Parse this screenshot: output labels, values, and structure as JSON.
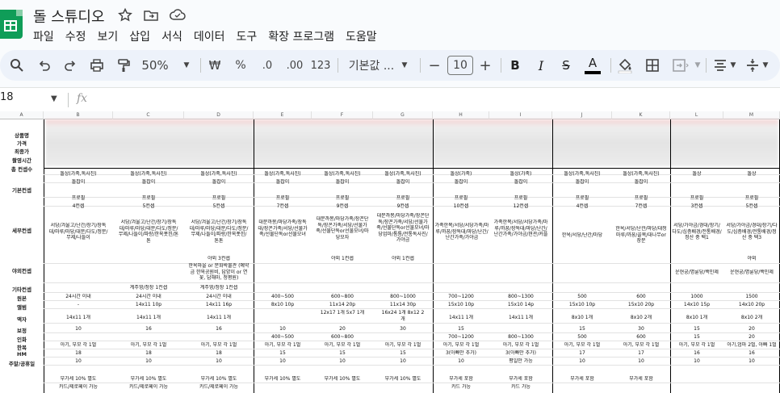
{
  "app": {
    "doc_title": "돌 스튜디오",
    "menu": [
      "파일",
      "수정",
      "보기",
      "삽입",
      "서식",
      "데이터",
      "도구",
      "확장 프로그램",
      "도움말"
    ]
  },
  "toolbar": {
    "zoom": "50%",
    "currency": "₩",
    "percent": "%",
    "dec_decrease": ".0",
    "dec_increase": ".00",
    "number_format": "123",
    "font_name": "기본값 ...",
    "font_size": "10",
    "minus": "−",
    "plus": "+",
    "bold": "B",
    "italic": "I",
    "strike": "S",
    "text_color": "A"
  },
  "formula_bar": {
    "cell_ref": "18",
    "fx": "fx"
  },
  "columns": [
    "A",
    "B",
    "C",
    "D",
    "E",
    "F",
    "G",
    "H",
    "I",
    "J",
    "K",
    "L",
    "M"
  ],
  "row_labels": {
    "r1": "상품명",
    "r2": "가격",
    "r3": "최종가",
    "r4": "촬영시간",
    "r5": "총 컨셉수",
    "r6": "기본컨셉",
    "r7": "세부컨셉",
    "r8": "야외컨셉",
    "r9": "기타컨셉",
    "r10": "원본",
    "r11": "앨범",
    "r12": "액자",
    "r13": "보정",
    "r14": "인화",
    "r15": "한복",
    "r16": "HM",
    "r17": "주말/공휴일"
  },
  "cells": {
    "B": {
      "row18": "돌상(가족,독사진)",
      "row19": "돌잡이",
      "row20": "프로필",
      "row21": "4컨셉",
      "detail": "서당/겨울고/난간/장기/장독대/마루/마당/대문/다도/정문/무제/나들이",
      "orig": "24시간 이내",
      "album": "-",
      "frame": "14x11 1개",
      "retouch": "10",
      "hanbok": "아기, 부모 각 1벌",
      "hm": "18",
      "weekend": "10",
      "extra": "부가세 10% 별도",
      "card": "카드/제로페이 가능"
    },
    "C": {
      "row18": "돌상(가족,독사진)",
      "row19": "돌잡이",
      "row20": "프로필",
      "row21": "5컨셉",
      "detail": "서당/겨울고/난간/장기/장독대/마루/마당/대문/다도/정문/무제/나들이/파랑/한옥폿힌/톤톤",
      "etc": "계주영/정장 1컨셉",
      "orig": "24시간 이내",
      "album": "14x11 10p",
      "frame": "14x11 1개",
      "retouch": "16",
      "hanbok": "아기, 부모 각 1벌",
      "hm": "18",
      "weekend": "10",
      "extra": "부가세 10% 별도",
      "card": "카드/제로페이 가능"
    },
    "D": {
      "row18": "돌상(가족,독사진)",
      "row19": "돌잡이",
      "row20": "프로필",
      "row21": "5컨셉",
      "detail": "서당/겨울고/난간/장기/장독대/마루/마당/대문/다도/정문/무제/나들이/파랑/한옥폿힌/톤톤",
      "outdoor1": "야외 3컨셉",
      "outdoor2": "한옥마을 or 문화박물관 (예약금 한옥공원비, 답양이 or 연꽃, 답해마, 청평원)",
      "etc": "계주영/정장 1컨셉",
      "orig": "24시간 이내",
      "album": "14x11 16p",
      "frame": "14x11 1개",
      "retouch": "16",
      "hanbok": "아기, 부모 각 1벌",
      "hm": "18",
      "weekend": "10",
      "extra": "부가세 10% 별도",
      "card": "카드/제로페이 가능"
    },
    "E": {
      "row18": "돌상(가족,독사진)",
      "row19": "돌잡이",
      "row20": "프로필",
      "row21": "7컨셉",
      "detail": "대문까몽/마당가족/장독대/장꼰가족/서당/선물가족/선물단독or선물모녀",
      "orig": "400~500",
      "album": "8x10 10p",
      "frame": "",
      "retouch": "10",
      "print": "400~500",
      "hanbok": "아기, 부모 각 1벌",
      "hm": "15",
      "weekend": "10",
      "extra": "부가세 10% 별도"
    },
    "F": {
      "row18": "돌상(가족,독사진)",
      "row19": "돌잡이",
      "row20": "프로필",
      "row21": "9컨셉",
      "detail": "대문까몽/마당가족/장꼰단독/장꼰가족/서당/선물가족/선물단독or선물모녀/마당모자",
      "outdoor1": "야외 1컨셉",
      "orig": "600~800",
      "album": "11x14 20p",
      "frame": "12x17 1개 5x7 1개",
      "retouch": "20",
      "print": "600~800",
      "hanbok": "아기, 부모 각 1벌",
      "hm": "15",
      "weekend": "10",
      "extra": "부가세 10% 별도"
    },
    "G": {
      "row18": "돌상(가족,독사진)",
      "row19": "돌잡이",
      "row20": "프로필",
      "row21": "9컨셉",
      "detail": "대문까몽/마당가족/장꼰단독/장꼰가족/서당/선물가족/선물단독or선물모녀/마당업마/톰톰/전통독사진/가야금",
      "outdoor1": "야외 1컨셉",
      "orig": "800~1000",
      "album": "11x14 30p",
      "frame": "16x24 1개 8x12 2개",
      "retouch": "30",
      "print": "600~800",
      "hanbok": "아기, 부모 각 1벌",
      "hm": "15",
      "weekend": "10",
      "extra": "부가세 10% 별도"
    },
    "H": {
      "row18": "돌상(가족)",
      "row19": "돌잡이",
      "row20": "프로필",
      "row21": "10컨셉",
      "detail": "가족한복/서당/서당가족/마루/까꿍/장독대/마당/난간/난간가족/가야금",
      "orig": "700~1200",
      "album": "15x10 10p",
      "frame": "14x11 1개",
      "retouch": "15",
      "print": "700~1200",
      "hanbok": "아기, 부모 각 1벌",
      "hm": "3(아빠만 추가)",
      "weekend": "10",
      "extra": "부가세 포함",
      "card": "카드 가능"
    },
    "I": {
      "row18": "돌상(가족)",
      "row19": "돌잡이",
      "row20": "프로필",
      "row21": "12컨셉",
      "detail": "가족한복/서당/서당가족/마루/까꿍/장독대/마당/난간/난간가족/가야금/현관/커플",
      "orig": "800~1300",
      "album": "15x10 14p",
      "frame": "14x11 1개",
      "retouch": "",
      "print": "800~1300",
      "hanbok": "아기, 부모 각 1벌",
      "hm": "3(아빠만 추가)",
      "weekend": "평일만 가능",
      "extra": "부가세 포함",
      "card": "카드 가능"
    },
    "J": {
      "row18": "돌상(가족,독사진)",
      "row19": "돌잡이",
      "row20": "프로필",
      "row21": "4컨셉",
      "detail": "한옥/서당/난간/마당",
      "orig": "500",
      "album": "15x10 10p",
      "frame": "8x10 1개",
      "retouch": "15",
      "print": "500",
      "hanbok": "아기, 부모 각 1벌",
      "hm": "17",
      "weekend": "10",
      "extra": "부가세 포함"
    },
    "K": {
      "row18": "돌상(가족,독사진)",
      "row19": "돌잡이",
      "row20": "프로필",
      "row21": "7컨셉",
      "detail": "한옥/서당/난관/마당/대청마루/까꿍/골목/대나무or장문",
      "orig": "600",
      "album": "15x10 20p",
      "frame": "8x10 2개",
      "retouch": "30",
      "print": "600",
      "hanbok": "아기, 부모 각 1벌",
      "hm": "17",
      "weekend": "10",
      "extra": "부가세 포함"
    },
    "L": {
      "row18": "돌상",
      "row20": "프로필",
      "row21": "3컨셉",
      "detail": "서당/가야금/경대/장기/다도/심층배경/전통배경/정산 중 택1",
      "outdoor2": "운현궁/명륜당/백인제",
      "orig": "1000",
      "album": "14x10 15p",
      "frame": "8x10 1개",
      "retouch": "15",
      "print": "15",
      "hanbok": "아기, 부모 각 1벌",
      "hm": "16",
      "weekend": "10"
    },
    "M": {
      "row18": "돌상",
      "row20": "프로필",
      "row21": "5컨셉",
      "detail": "서당/가야금/경대/장기/다도/심층배경/전통배경/정산 중 택3",
      "outdoor1": "야외",
      "outdoor2": "운현궁/명륜당/백인제",
      "orig": "1500",
      "album": "14x10 20p",
      "frame": "8x10 2개",
      "retouch": "20",
      "print": "20",
      "hanbok": "아기,엄마 2벌, 아빠 1벌",
      "hm": "16",
      "weekend": "10"
    }
  }
}
